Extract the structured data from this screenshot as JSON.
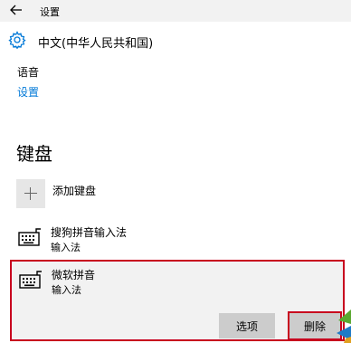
{
  "window": {
    "title": "设置"
  },
  "header": {
    "title": "中文(中华人民共和国)"
  },
  "voice": {
    "label": "语音",
    "settings_link": "设置"
  },
  "keyboards": {
    "heading": "键盘",
    "add_label": "添加键盘",
    "items": [
      {
        "name": "搜狗拼音输入法",
        "type": "输入法"
      },
      {
        "name": "微软拼音",
        "type": "输入法"
      }
    ],
    "selected_index": 1
  },
  "actions": {
    "options_label": "选项",
    "delete_label": "删除"
  },
  "colors": {
    "accent_link": "#0078d7",
    "highlight_border": "#c8001e",
    "button_bg": "#cccccc",
    "titlebar_bg": "#f2f2f2"
  },
  "icons": {
    "back": "back-arrow-icon",
    "settings": "gear-icon",
    "add": "plus-icon",
    "keyboard": "keyboard-icon"
  }
}
